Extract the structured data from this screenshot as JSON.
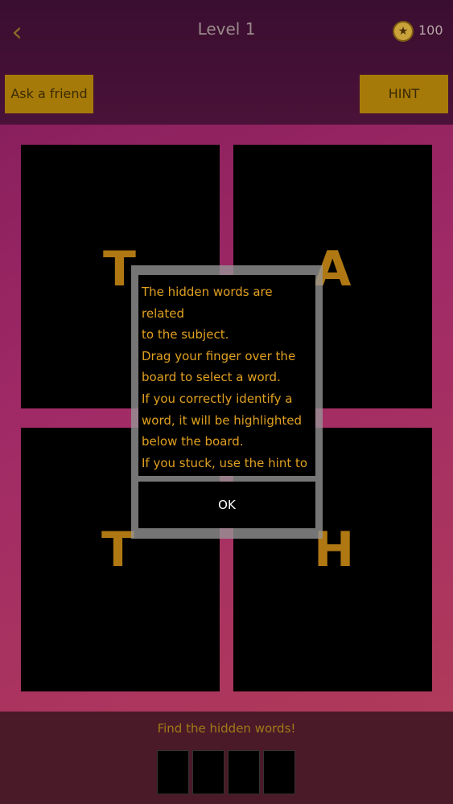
{
  "header": {
    "back_icon": "chevron-left-icon",
    "title": "Level 1",
    "coin_icon": "star-coin-icon",
    "coins": "100"
  },
  "toolbar": {
    "ask_label": "Ask a friend",
    "hint_label": "HINT"
  },
  "board": {
    "letters": [
      "T",
      "A",
      "T",
      "H"
    ]
  },
  "footer": {
    "prompt": "Find the hidden words!",
    "slots": 4
  },
  "modal": {
    "message_lines": [
      "The hidden words are related",
      "to the subject.",
      "Drag your finger over the",
      "board to select a word.",
      "If you correctly identify a",
      "word, it will be highlighted",
      "below the board.",
      "If you stuck, use the hint to"
    ],
    "ok_label": "OK"
  },
  "colors": {
    "accent_gold": "#a67a08",
    "letter_gold": "#b07812",
    "board_bg": "#a02a66",
    "header_bg": "#3a0e30",
    "modal_text": "#e0a020"
  }
}
